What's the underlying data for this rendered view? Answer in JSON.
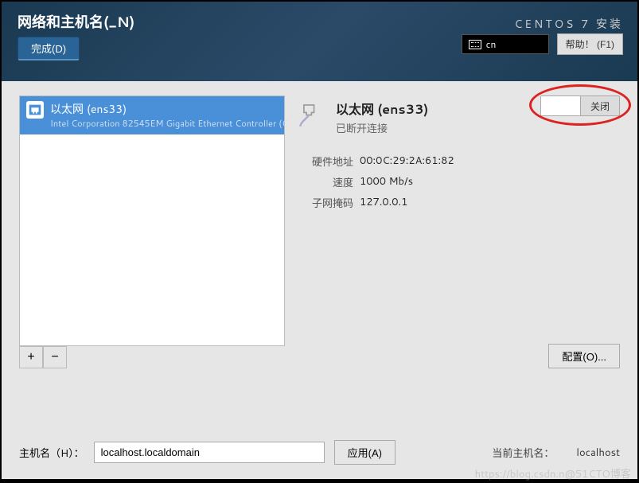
{
  "header": {
    "title": "网络和主机名(_N)",
    "done_label": "完成(D)",
    "installer_title": "CENTOS 7 安装",
    "input_method": "cn",
    "help_label": "帮助！ (F1)"
  },
  "device_list": {
    "items": [
      {
        "name": "以太网 (ens33)",
        "desc": "Intel Corporation 82545EM Gigabit Ethernet Controller (C"
      }
    ]
  },
  "connection": {
    "title": "以太网 (ens33)",
    "status": "已断开连接",
    "toggle_label": "关闭",
    "toggle_state": "off",
    "details": [
      {
        "label": "硬件地址",
        "value": "00:0C:29:2A:61:82"
      },
      {
        "label": "速度",
        "value": "1000 Mb/s"
      },
      {
        "label": "子网掩码",
        "value": "127.0.0.1"
      }
    ],
    "configure_label": "配置(O)..."
  },
  "hostname": {
    "label": "主机名（H）：",
    "value": "localhost.localdomain",
    "apply_label": "应用(A)",
    "current_label": "当前主机名：",
    "current_value": "localhost"
  },
  "buttons": {
    "add": "+",
    "remove": "−"
  },
  "watermark": "https://blog.csdn.n@51CTO博客"
}
